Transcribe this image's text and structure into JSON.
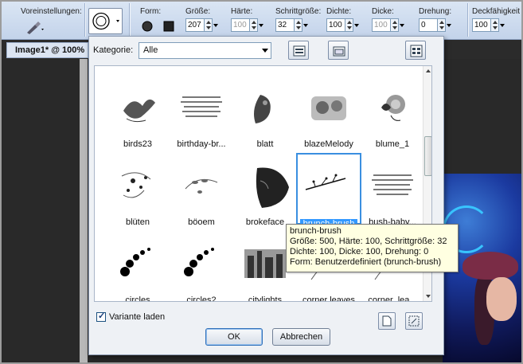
{
  "toolbar": {
    "presets_label": "Voreinstellungen:",
    "form_label": "Form:",
    "size_label": "Größe:",
    "size_value": "207",
    "hardness_label": "Härte:",
    "hardness_value": "100",
    "step_label": "Schrittgröße:",
    "step_value": "32",
    "density_label": "Dichte:",
    "density_value": "100",
    "thickness_label": "Dicke:",
    "thickness_value": "100",
    "rotation_label": "Drehung:",
    "rotation_value": "0",
    "opacity_label": "Deckfähigkeit",
    "opacity_value": "100"
  },
  "document": {
    "tab_title": "Image1* @ 100%"
  },
  "dialog": {
    "category_label": "Kategorie:",
    "category_value": "Alle",
    "brushes": [
      {
        "label": "birds23",
        "icon": "birds-icon"
      },
      {
        "label": "birthday-br...",
        "icon": "text-brush-icon"
      },
      {
        "label": "blatt",
        "icon": "leaf-icon"
      },
      {
        "label": "blazeMelody",
        "icon": "blaze-icon"
      },
      {
        "label": "blume_1",
        "icon": "flower-icon"
      },
      {
        "label": "blüten",
        "icon": "blossom-icon"
      },
      {
        "label": "böoem",
        "icon": "vine-icon"
      },
      {
        "label": "brokeface",
        "icon": "broken-face-icon"
      },
      {
        "label": "brunch-brush",
        "icon": "branch-icon"
      },
      {
        "label": "bush-baby...",
        "icon": "text-brush-icon"
      },
      {
        "label": "circles",
        "icon": "circles-icon"
      },
      {
        "label": "circles2",
        "icon": "circles-icon"
      },
      {
        "label": "citylights",
        "icon": "city-icon"
      },
      {
        "label": "corner leaves",
        "icon": "corner-leaves-icon"
      },
      {
        "label": "corner_lea...",
        "icon": "corner-leaves-icon"
      }
    ],
    "selected_brush": "brunch-brush",
    "tooltip": {
      "name": "brunch-brush",
      "line1": "Größe: 500, Härte: 100, Schrittgröße: 32",
      "line2": "Dichte: 100, Dicke: 100, Drehung: 0",
      "line3": "Form: Benutzerdefiniert (brunch-brush)"
    },
    "checkbox_label": "Variante laden",
    "checkbox_checked": true,
    "ok_label": "OK",
    "cancel_label": "Abbrechen"
  }
}
